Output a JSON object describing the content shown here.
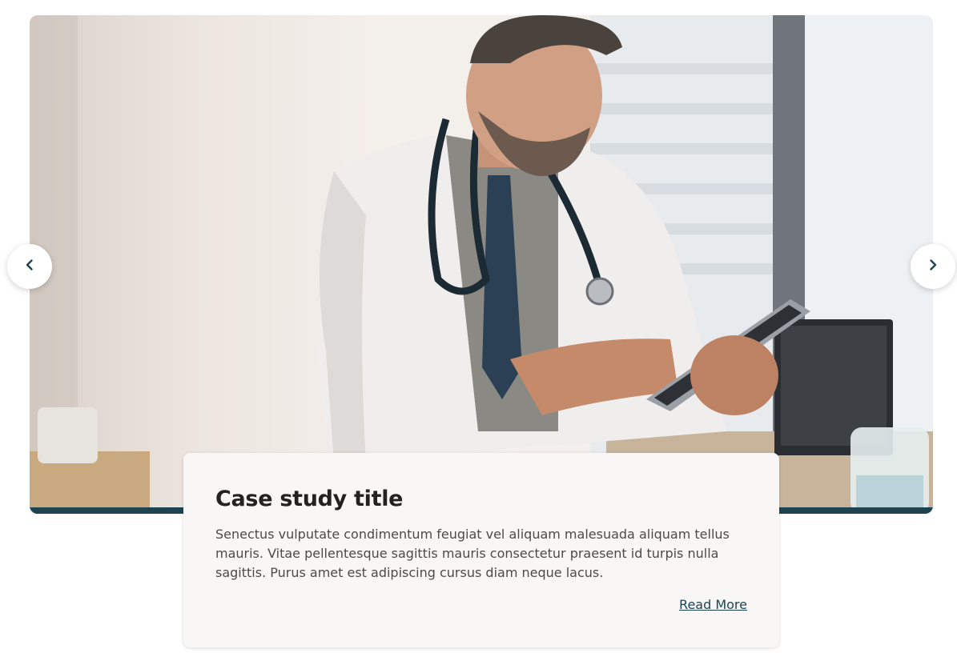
{
  "carousel": {
    "hero_image_icon": "doctor-with-tablet-photo",
    "accent_color": "#1e4452",
    "prev_icon": "chevron-left-icon",
    "next_icon": "chevron-right-icon"
  },
  "card": {
    "title": "Case study title",
    "body": "Senectus vulputate condimentum feugiat vel aliquam malesuada aliquam tellus mauris. Vitae pellentesque sagittis mauris consectetur praesent id turpis nulla sagittis. Purus amet est adipiscing cursus diam neque lacus.",
    "read_more_label": "Read More"
  }
}
